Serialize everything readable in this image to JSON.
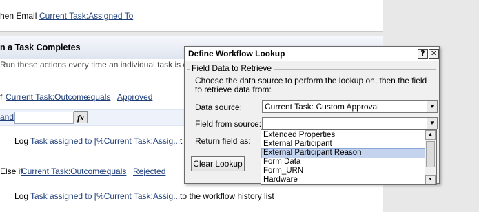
{
  "background": {
    "email_line": {
      "prefix": "hen Email",
      "field": "Current Task:Assigned To"
    },
    "section_title": "n a Task Completes",
    "section_desc": "Run these actions every time an individual task is co",
    "if_line": {
      "prefix": "f",
      "field": "Current Task:Outcome",
      "op": "equals",
      "value": "Approved"
    },
    "and_label": "and",
    "fx_label": "fx",
    "log1": {
      "prefix": "Log",
      "link": "Task assigned to [%Current Task:Assig...",
      "suffix": "t"
    },
    "else_line": {
      "prefix": "Else if",
      "field": "Current Task:Outcome",
      "op": "equals",
      "value": "Rejected"
    },
    "log2": {
      "prefix": "Log",
      "link": "Task assigned to [%Current Task:Assig...",
      "suffix": "to the workflow history list"
    }
  },
  "dialog": {
    "title": "Define Workflow Lookup",
    "help_glyph": "?",
    "close_glyph": "✕",
    "group_label": "Field Data to Retrieve",
    "instructions": "Choose the data source to perform the lookup on, then the field to retrieve data from:",
    "data_source_label": "Data source:",
    "data_source_value": "Current Task: Custom Approval",
    "field_from_source_label": "Field from source:",
    "field_from_source_value": "",
    "return_field_label": "Return field as:",
    "clear_button": "Clear Lookup",
    "dropdown_items": [
      "Extended Properties",
      "External Participant",
      "External Participant Reason",
      "Form Data",
      "Form_URN",
      "Hardware"
    ],
    "selected_index": 2
  },
  "icons": {
    "dropdown_arrow": "chevron-down-icon",
    "scroll_up": "chevron-up-icon"
  }
}
